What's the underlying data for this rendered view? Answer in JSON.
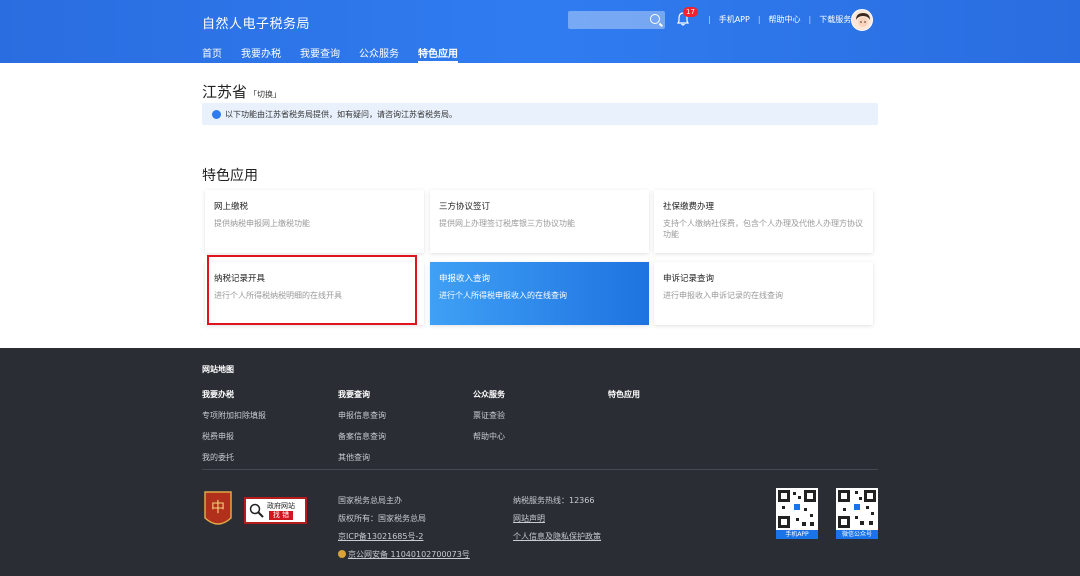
{
  "header": {
    "brand": "自然人电子税务局",
    "nav": [
      "首页",
      "我要办税",
      "我要查询",
      "公众服务",
      "特色应用"
    ],
    "active_nav": "特色应用",
    "notification_count": "17",
    "links": [
      "手机APP",
      "帮助中心",
      "下载服务"
    ]
  },
  "main": {
    "province": "江苏省",
    "province_switch": "「切换」",
    "notice": "以下功能由江苏省税务局提供，如有疑问，请咨询江苏省税务局。",
    "section_title": "特色应用",
    "cards": [
      {
        "title": "网上缴税",
        "desc": "提供纳税申报网上缴税功能"
      },
      {
        "title": "三方协议签订",
        "desc": "提供网上办理签订税库银三方协议功能"
      },
      {
        "title": "社保缴费办理",
        "desc": "支持个人缴纳社保费，包含个人办理及代他人办理方协议功能"
      },
      {
        "title": "纳税记录开具",
        "desc": "进行个人所得税纳税明细的在线开具"
      },
      {
        "title": "申报收入查询",
        "desc": "进行个人所得税申报收入的在线查询"
      },
      {
        "title": "申诉记录查询",
        "desc": "进行申报收入申诉记录的在线查询"
      }
    ]
  },
  "footer": {
    "site_map": "网站地图",
    "columns": [
      {
        "head": "我要办税",
        "items": [
          "专项附加扣除填报",
          "税费申报",
          "我的委托"
        ]
      },
      {
        "head": "我要查询",
        "items": [
          "申报信息查询",
          "备案信息查询",
          "其他查询"
        ]
      },
      {
        "head": "公众服务",
        "items": [
          "票证查验",
          "帮助中心"
        ]
      },
      {
        "head": "特色应用",
        "items": []
      }
    ],
    "gov_badge": {
      "line1": "政府网站",
      "line2": "找 错"
    },
    "info_left": [
      "国家税务总局主办",
      "版权所有：国家税务总局",
      "京ICP备13021685号-2",
      "京公网安备 11040102700073号"
    ],
    "info_right": [
      "纳税服务热线：12366",
      "网站声明",
      "个人信息及隐私保护政策"
    ],
    "qr_labels": [
      "手机APP",
      "微信公众号"
    ]
  }
}
